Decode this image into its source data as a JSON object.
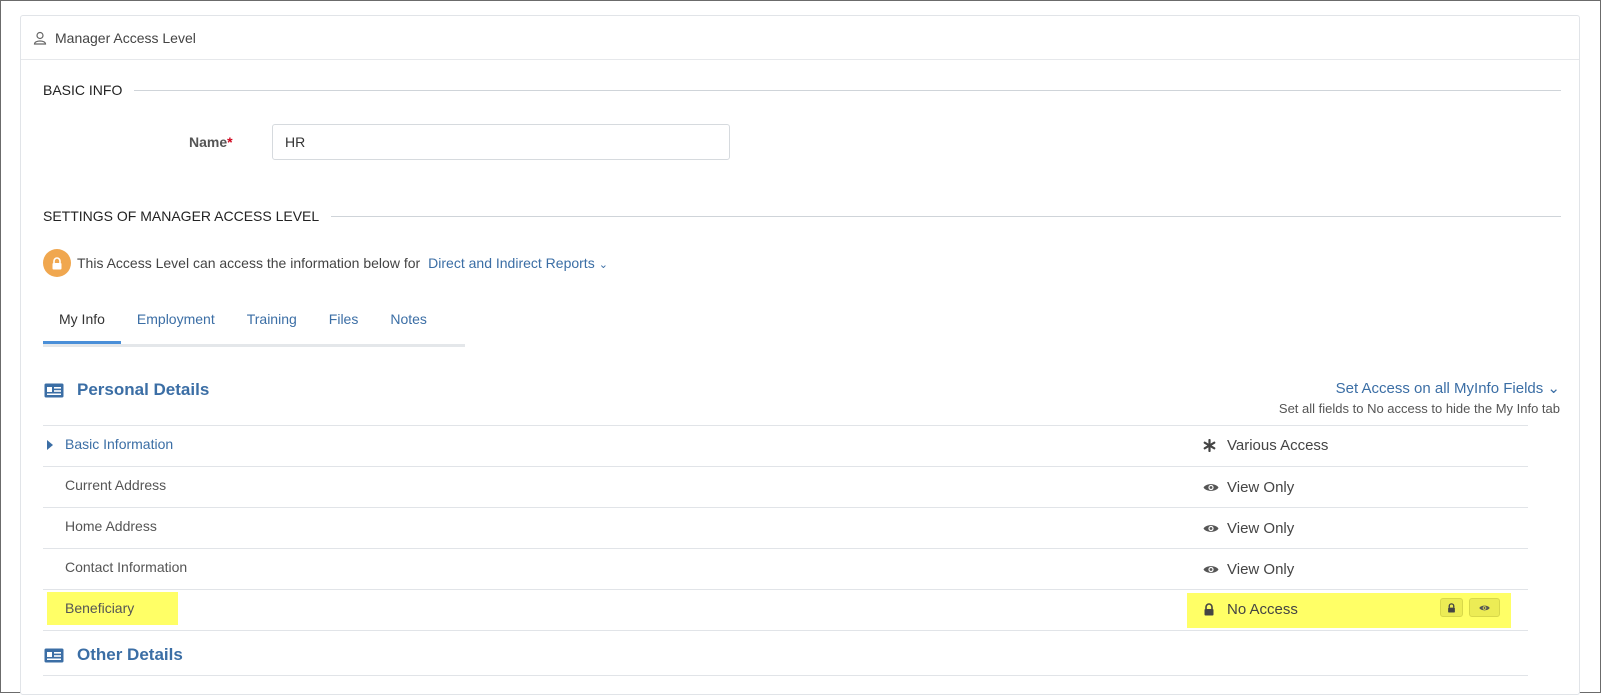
{
  "panel": {
    "title": "Manager Access Level"
  },
  "basic_info": {
    "section_title": "BASIC INFO",
    "name_label": "Name",
    "name_required_mark": "*",
    "name_value": "HR"
  },
  "settings": {
    "section_title": "SETTINGS OF MANAGER ACCESS LEVEL",
    "access_text": "This Access Level can access the information below for",
    "scope_link": "Direct and Indirect Reports",
    "scope_chevron": "⌄"
  },
  "tabs": [
    {
      "label": "My Info",
      "active": true
    },
    {
      "label": "Employment",
      "active": false
    },
    {
      "label": "Training",
      "active": false
    },
    {
      "label": "Files",
      "active": false
    },
    {
      "label": "Notes",
      "active": false
    }
  ],
  "personal_details": {
    "title": "Personal Details",
    "set_access_link": "Set Access on all MyInfo Fields",
    "set_access_chevron": "⌄",
    "set_access_hint": "Set all fields to No access to hide the My Info tab",
    "rows": [
      {
        "label": "Basic Information",
        "access": "Various Access",
        "icon": "asterisk-icon",
        "expandable": true
      },
      {
        "label": "Current Address",
        "access": "View Only",
        "icon": "eye-icon",
        "expandable": false
      },
      {
        "label": "Home Address",
        "access": "View Only",
        "icon": "eye-icon",
        "expandable": false
      },
      {
        "label": "Contact Information",
        "access": "View Only",
        "icon": "eye-icon",
        "expandable": false
      },
      {
        "label": "Beneficiary",
        "access": "No Access",
        "icon": "lock-icon",
        "expandable": false,
        "highlighted": true
      }
    ]
  },
  "other_details": {
    "title": "Other Details"
  },
  "colors": {
    "link": "#3b6ea5",
    "accent_orange": "#f0a74f",
    "highlight": "#ffff66",
    "tab_active": "#4a8fd8"
  }
}
